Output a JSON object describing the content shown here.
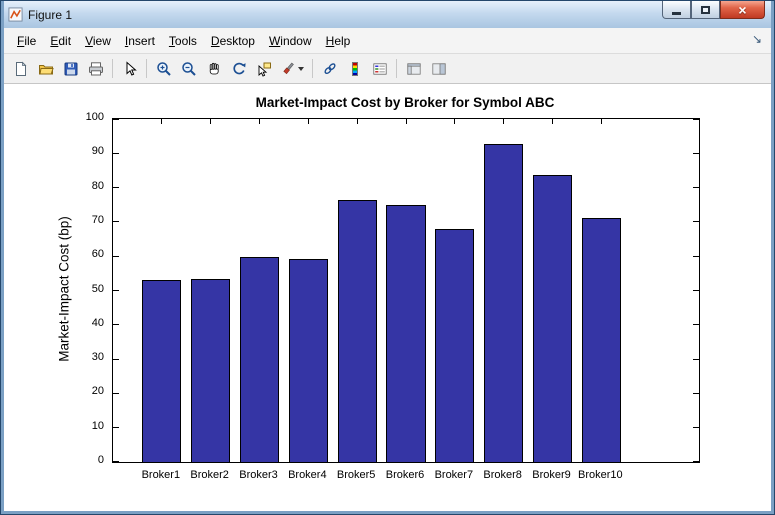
{
  "window": {
    "title": "Figure 1",
    "controls": [
      "minimize",
      "maximize",
      "close"
    ]
  },
  "menu_bar": {
    "items": [
      "File",
      "Edit",
      "View",
      "Insert",
      "Tools",
      "Desktop",
      "Window",
      "Help"
    ],
    "dock_arrow": "↘"
  },
  "toolbar": {
    "icons": [
      "new-figure",
      "open-file",
      "save-figure",
      "print-figure",
      "edit-plot",
      "zoom-in",
      "zoom-out",
      "pan",
      "rotate-3d",
      "data-cursor",
      "brush",
      "link-plot",
      "insert-colorbar",
      "insert-legend",
      "hide-plot-tools",
      "show-plot-tools"
    ]
  },
  "chart_data": {
    "type": "bar",
    "title": "Market-Impact Cost by Broker for Symbol ABC",
    "xlabel": "",
    "ylabel": "Market-Impact Cost (bp)",
    "categories": [
      "Broker1",
      "Broker2",
      "Broker3",
      "Broker4",
      "Broker5",
      "Broker6",
      "Broker7",
      "Broker8",
      "Broker9",
      "Broker10"
    ],
    "values": [
      53.0,
      53.5,
      59.8,
      59.2,
      76.3,
      75.0,
      67.8,
      92.8,
      83.7,
      71.0
    ],
    "ylim": [
      0,
      100
    ],
    "ytick_step": 10,
    "xlim": [
      0,
      12
    ],
    "bar_width_fraction": 0.8,
    "bar_color": "#3535a5",
    "bar_edge_color": "#000000",
    "grid": false,
    "legend_position": "none",
    "axes_background": "#ffffff"
  }
}
